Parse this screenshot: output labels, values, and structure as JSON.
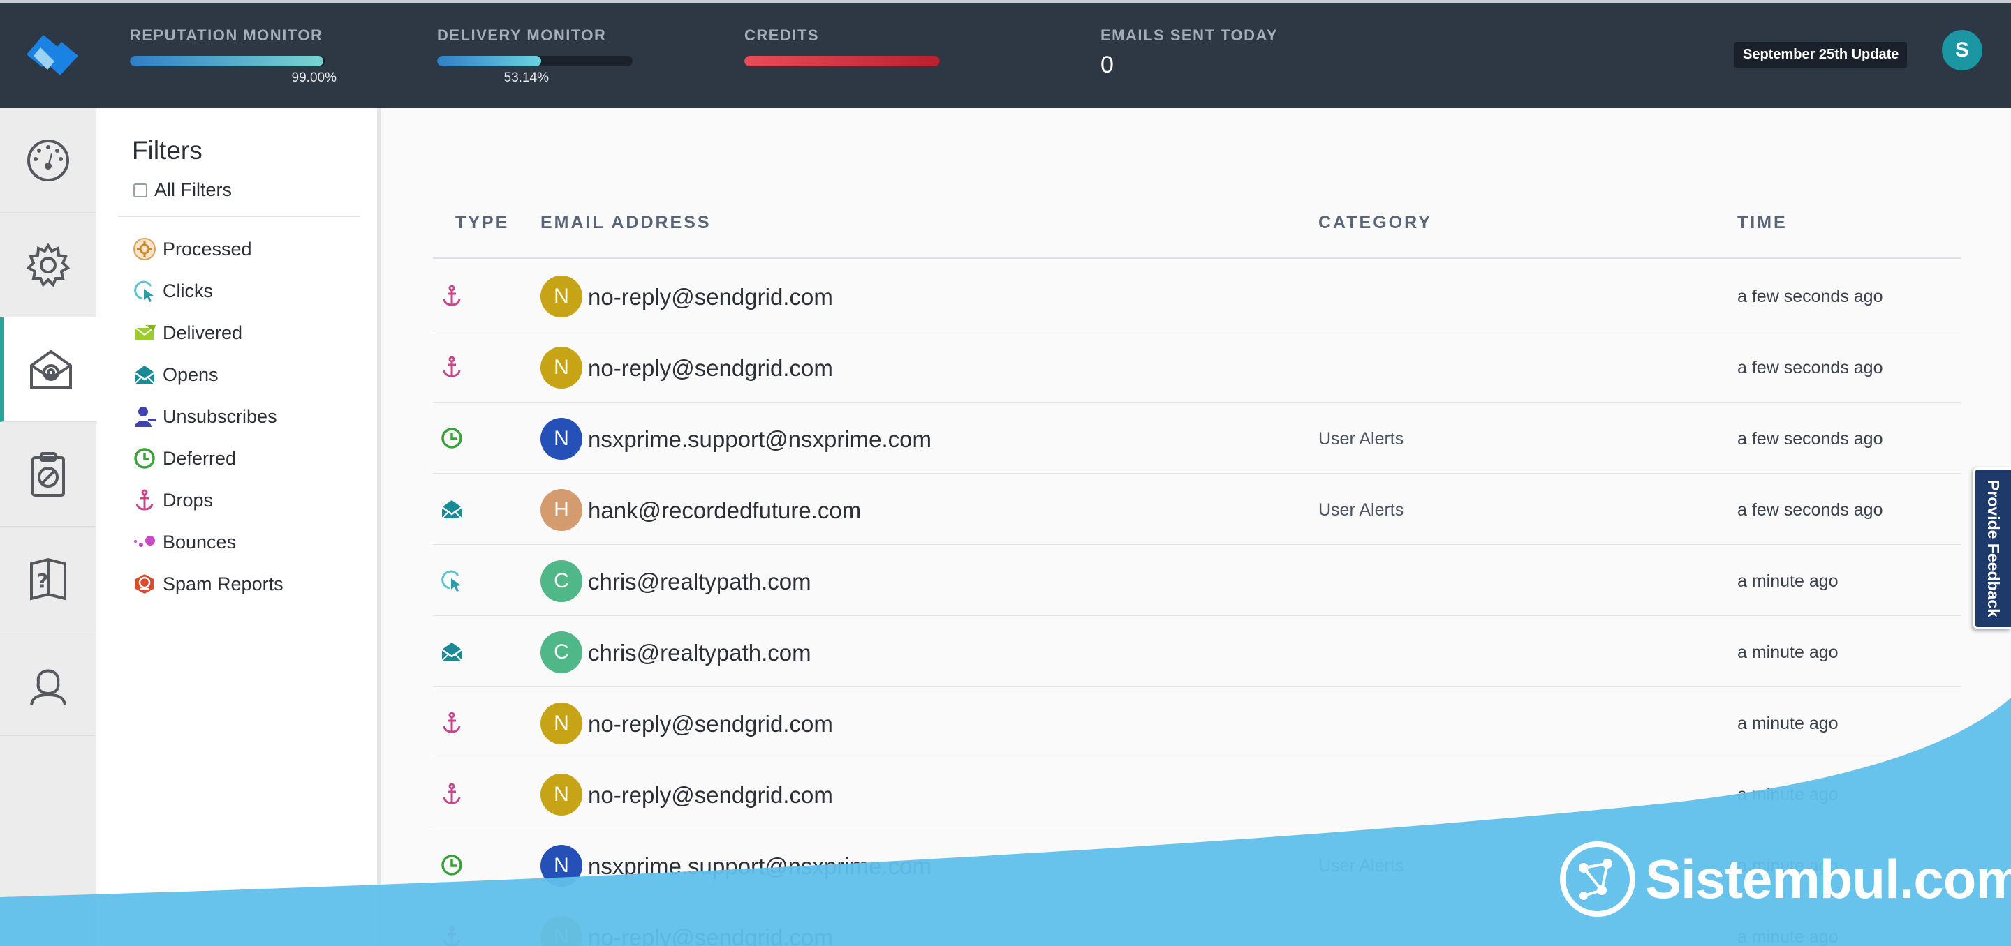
{
  "header": {
    "reputation": {
      "label": "REPUTATION MONITOR",
      "percent_text": "99.00%",
      "fill": 0.99,
      "color_from": "#2f7fc7",
      "color_to": "#76d5cf"
    },
    "delivery": {
      "label": "DELIVERY MONITOR",
      "percent_text": "53.14%",
      "fill": 0.5314,
      "color_from": "#2f7fc7",
      "color_to": "#6ad3e0"
    },
    "credits": {
      "label": "CREDITS",
      "fill": 1.0,
      "color_from": "#e94d59",
      "color_to": "#b8202d"
    },
    "emails_sent": {
      "label": "EMAILS SENT TODAY",
      "value": "0"
    },
    "update_button": "September 25th Update",
    "avatar_initial": "S"
  },
  "rail": [
    "dashboard-icon",
    "settings-icon",
    "email-activity-icon",
    "suppressions-icon",
    "help-icon",
    "account-icon"
  ],
  "filters": {
    "title": "Filters",
    "all_label": "All Filters",
    "items": [
      {
        "label": "Processed",
        "icon": "processed-icon"
      },
      {
        "label": "Clicks",
        "icon": "click-icon"
      },
      {
        "label": "Delivered",
        "icon": "delivered-icon"
      },
      {
        "label": "Opens",
        "icon": "open-icon"
      },
      {
        "label": "Unsubscribes",
        "icon": "unsubscribe-icon"
      },
      {
        "label": "Deferred",
        "icon": "deferred-icon"
      },
      {
        "label": "Drops",
        "icon": "drop-icon"
      },
      {
        "label": "Bounces",
        "icon": "bounce-icon"
      },
      {
        "label": "Spam Reports",
        "icon": "spam-icon"
      }
    ]
  },
  "table": {
    "headers": {
      "type": "TYPE",
      "email": "EMAIL ADDRESS",
      "category": "CATEGORY",
      "time": "TIME"
    },
    "rows": [
      {
        "type": "drop",
        "initial": "N",
        "avatar_color": "#c7a416",
        "email": "no-reply@sendgrid.com",
        "category": "",
        "time": "a few seconds ago"
      },
      {
        "type": "drop",
        "initial": "N",
        "avatar_color": "#c7a416",
        "email": "no-reply@sendgrid.com",
        "category": "",
        "time": "a few seconds ago"
      },
      {
        "type": "deferred",
        "initial": "N",
        "avatar_color": "#2450b8",
        "email": "nsxprime.support@nsxprime.com",
        "category": "User Alerts",
        "time": "a few seconds ago"
      },
      {
        "type": "open",
        "initial": "H",
        "avatar_color": "#d49b6e",
        "email": "hank@recordedfuture.com",
        "category": "User Alerts",
        "time": "a few seconds ago"
      },
      {
        "type": "click",
        "initial": "C",
        "avatar_color": "#50b888",
        "email": "chris@realtypath.com",
        "category": "",
        "time": "a minute ago"
      },
      {
        "type": "open",
        "initial": "C",
        "avatar_color": "#50b888",
        "email": "chris@realtypath.com",
        "category": "",
        "time": "a minute ago"
      },
      {
        "type": "drop",
        "initial": "N",
        "avatar_color": "#c7a416",
        "email": "no-reply@sendgrid.com",
        "category": "",
        "time": "a minute ago"
      },
      {
        "type": "drop",
        "initial": "N",
        "avatar_color": "#c7a416",
        "email": "no-reply@sendgrid.com",
        "category": "",
        "time": "a minute ago"
      },
      {
        "type": "deferred",
        "initial": "N",
        "avatar_color": "#2450b8",
        "email": "nsxprime.support@nsxprime.com",
        "category": "User Alerts",
        "time": "a minute ago"
      },
      {
        "type": "drop",
        "initial": "N",
        "avatar_color": "#c7a416",
        "email": "no-reply@sendgrid.com",
        "category": "",
        "time": "a minute ago"
      }
    ]
  },
  "feedback_tab": "Provide Feedback",
  "watermark": "Sistembul.com",
  "colors": {
    "topbar": "#2e3744",
    "accent": "#2aa59a",
    "watermark": "#5fc0ea"
  }
}
